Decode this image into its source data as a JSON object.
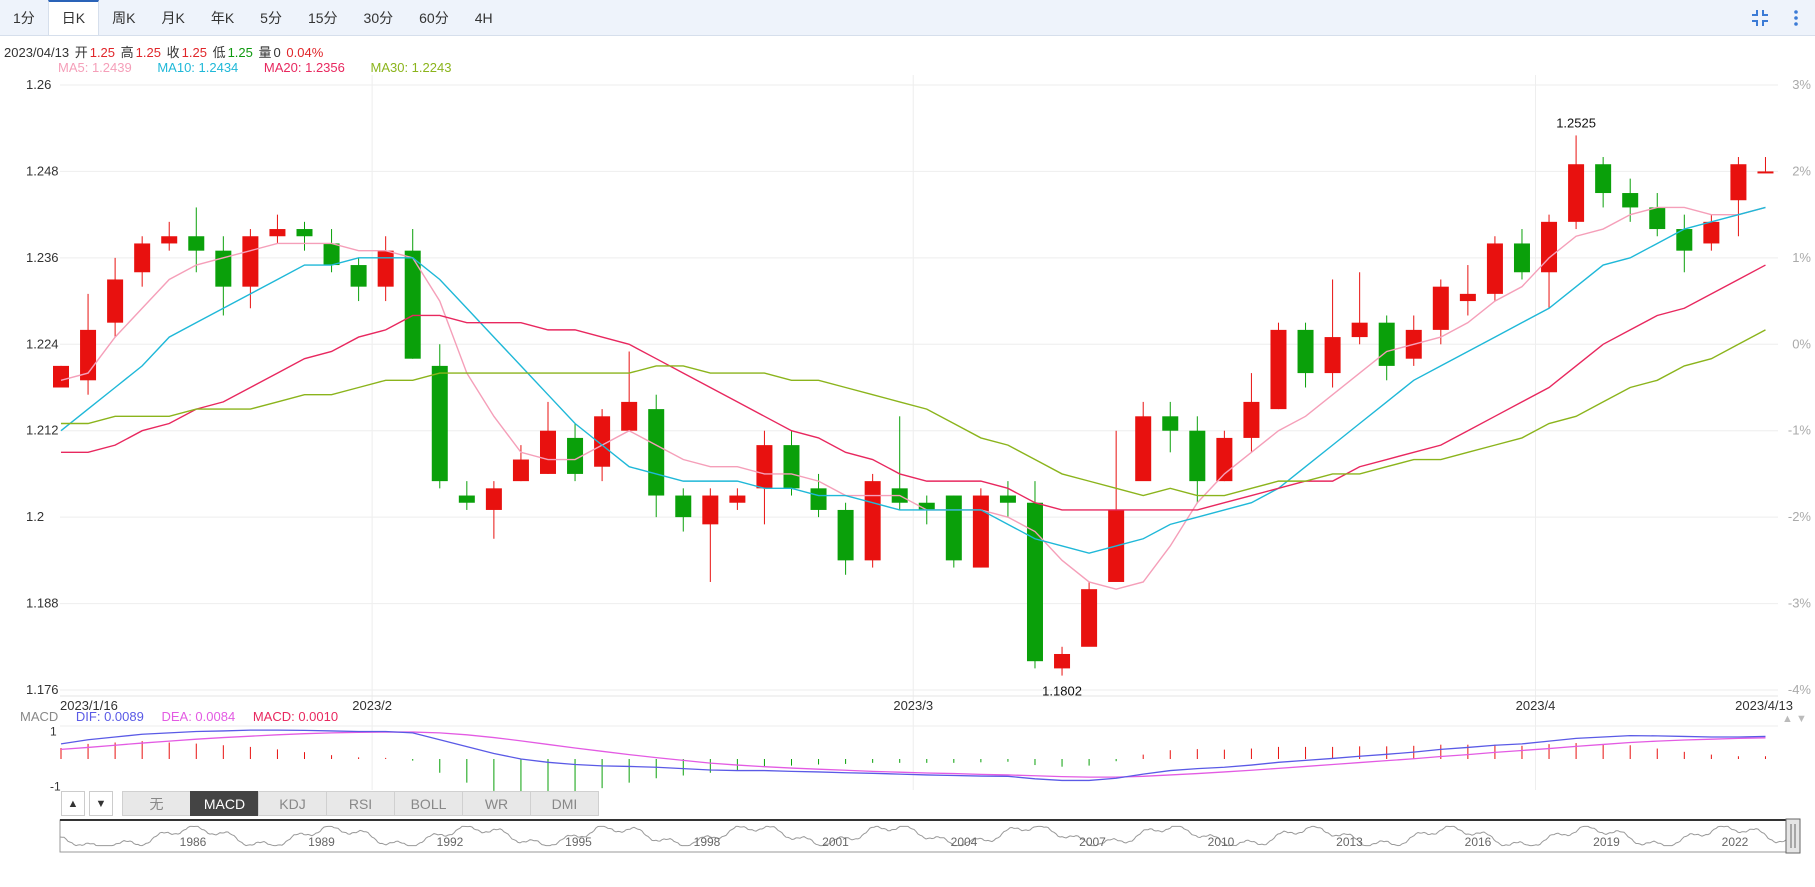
{
  "toolbar": {
    "timeframes": [
      "1分",
      "日K",
      "周K",
      "月K",
      "年K",
      "5分",
      "15分",
      "30分",
      "60分",
      "4H"
    ],
    "active_index": 1
  },
  "info": {
    "date": "2023/04/13",
    "open_label": "开",
    "open": "1.25",
    "high_label": "高",
    "high": "1.25",
    "close_label": "收",
    "close": "1.25",
    "low_label": "低",
    "low": "1.25",
    "vol_label": "量",
    "vol": "0",
    "change": "0.04%"
  },
  "ma": [
    {
      "label": "MA5: 1.2439",
      "color": "#f59fb9"
    },
    {
      "label": "MA10: 1.2434",
      "color": "#1fb8d8"
    },
    {
      "label": "MA20: 1.2356",
      "color": "#e8285f"
    },
    {
      "label": "MA30: 1.2243",
      "color": "#8bb41c"
    }
  ],
  "macd_legend": {
    "name": "MACD",
    "dif": "DIF: 0.0089",
    "dea": "DEA: 0.0084",
    "macd": "MACD: 0.0010"
  },
  "indicator_tabs": {
    "up": "▲",
    "down": "▼",
    "tabs": [
      "无",
      "MACD",
      "KDJ",
      "RSI",
      "BOLL",
      "WR",
      "DMI"
    ],
    "active_index": 1
  },
  "overview": {
    "year_labels": [
      "1986",
      "1989",
      "1992",
      "1995",
      "1998",
      "2001",
      "2004",
      "2007",
      "2010",
      "2013",
      "2016",
      "2019",
      "2022"
    ]
  },
  "colors": {
    "up": "#e8110f",
    "down": "#0aa00a",
    "ma5": "#f59fb9",
    "ma10": "#1fb8d8",
    "ma20": "#e8285f",
    "ma30": "#8bb41c",
    "dif": "#5a5ae6",
    "dea": "#e35be3"
  },
  "chart_data": {
    "type": "candlestick",
    "price_axis": {
      "min": 1.176,
      "max": 1.26,
      "ticks": [
        "1.26",
        "1.248",
        "1.236",
        "1.224",
        "1.212",
        "1.2",
        "1.188",
        "1.176"
      ]
    },
    "pct_axis": {
      "ticks": [
        "3%",
        "2%",
        "1%",
        "0%",
        "-1%",
        "-2%",
        "-3%",
        "-4%"
      ]
    },
    "date_labels": [
      "2023/1/16",
      "2023/2",
      "2023/3",
      "2023/4",
      "2023/4/13"
    ],
    "annotations": {
      "max_label": "1.2525",
      "min_label": "1.1802"
    },
    "ohlc": [
      [
        1.218,
        1.221,
        1.218,
        1.221
      ],
      [
        1.219,
        1.226,
        1.231,
        1.217
      ],
      [
        1.227,
        1.233,
        1.236,
        1.225
      ],
      [
        1.234,
        1.238,
        1.239,
        1.232
      ],
      [
        1.238,
        1.239,
        1.241,
        1.237
      ],
      [
        1.239,
        1.237,
        1.243,
        1.234
      ],
      [
        1.237,
        1.232,
        1.239,
        1.228
      ],
      [
        1.232,
        1.239,
        1.24,
        1.229
      ],
      [
        1.239,
        1.24,
        1.242,
        1.238
      ],
      [
        1.24,
        1.239,
        1.241,
        1.237
      ],
      [
        1.238,
        1.235,
        1.24,
        1.234
      ],
      [
        1.235,
        1.232,
        1.236,
        1.23
      ],
      [
        1.232,
        1.237,
        1.239,
        1.23
      ],
      [
        1.237,
        1.222,
        1.24,
        1.222
      ],
      [
        1.221,
        1.205,
        1.224,
        1.204
      ],
      [
        1.203,
        1.202,
        1.205,
        1.201
      ],
      [
        1.201,
        1.204,
        1.205,
        1.197
      ],
      [
        1.205,
        1.208,
        1.21,
        1.205
      ],
      [
        1.206,
        1.212,
        1.216,
        1.206
      ],
      [
        1.211,
        1.206,
        1.213,
        1.205
      ],
      [
        1.207,
        1.214,
        1.215,
        1.205
      ],
      [
        1.212,
        1.216,
        1.223,
        1.212
      ],
      [
        1.215,
        1.203,
        1.217,
        1.2
      ],
      [
        1.203,
        1.2,
        1.204,
        1.198
      ],
      [
        1.199,
        1.203,
        1.204,
        1.191
      ],
      [
        1.202,
        1.203,
        1.204,
        1.201
      ],
      [
        1.204,
        1.21,
        1.212,
        1.199
      ],
      [
        1.21,
        1.204,
        1.212,
        1.203
      ],
      [
        1.204,
        1.201,
        1.206,
        1.2
      ],
      [
        1.201,
        1.194,
        1.202,
        1.192
      ],
      [
        1.194,
        1.205,
        1.206,
        1.193
      ],
      [
        1.204,
        1.202,
        1.214,
        1.201
      ],
      [
        1.202,
        1.201,
        1.203,
        1.199
      ],
      [
        1.203,
        1.194,
        1.203,
        1.193
      ],
      [
        1.193,
        1.203,
        1.204,
        1.193
      ],
      [
        1.203,
        1.202,
        1.205,
        1.2
      ],
      [
        1.202,
        1.18,
        1.205,
        1.179
      ],
      [
        1.179,
        1.181,
        1.182,
        1.178
      ],
      [
        1.182,
        1.19,
        1.191,
        1.184
      ],
      [
        1.191,
        1.201,
        1.212,
        1.192
      ],
      [
        1.205,
        1.214,
        1.216,
        1.206
      ],
      [
        1.214,
        1.212,
        1.216,
        1.209
      ],
      [
        1.212,
        1.205,
        1.214,
        1.202
      ],
      [
        1.205,
        1.211,
        1.212,
        1.205
      ],
      [
        1.211,
        1.216,
        1.22,
        1.209
      ],
      [
        1.215,
        1.226,
        1.227,
        1.215
      ],
      [
        1.226,
        1.22,
        1.227,
        1.218
      ],
      [
        1.22,
        1.225,
        1.233,
        1.218
      ],
      [
        1.225,
        1.227,
        1.234,
        1.224
      ],
      [
        1.227,
        1.221,
        1.228,
        1.219
      ],
      [
        1.222,
        1.226,
        1.228,
        1.221
      ],
      [
        1.226,
        1.232,
        1.233,
        1.224
      ],
      [
        1.23,
        1.231,
        1.235,
        1.228
      ],
      [
        1.231,
        1.238,
        1.239,
        1.23
      ],
      [
        1.238,
        1.234,
        1.24,
        1.233
      ],
      [
        1.234,
        1.241,
        1.242,
        1.229
      ],
      [
        1.241,
        1.249,
        1.253,
        1.24
      ],
      [
        1.249,
        1.245,
        1.25,
        1.243
      ],
      [
        1.245,
        1.243,
        1.247,
        1.241
      ],
      [
        1.243,
        1.24,
        1.245,
        1.239
      ],
      [
        1.24,
        1.237,
        1.242,
        1.234
      ],
      [
        1.238,
        1.241,
        1.242,
        1.237
      ],
      [
        1.244,
        1.249,
        1.25,
        1.239
      ],
      [
        1.248,
        1.248,
        1.25,
        1.248
      ]
    ],
    "ma5": [
      1.219,
      1.22,
      1.225,
      1.229,
      1.233,
      1.235,
      1.236,
      1.237,
      1.238,
      1.238,
      1.238,
      1.237,
      1.237,
      1.236,
      1.23,
      1.22,
      1.214,
      1.209,
      1.208,
      1.208,
      1.21,
      1.212,
      1.21,
      1.208,
      1.207,
      1.207,
      1.206,
      1.206,
      1.205,
      1.203,
      1.203,
      1.203,
      1.201,
      1.201,
      1.201,
      1.2,
      1.198,
      1.194,
      1.191,
      1.19,
      1.191,
      1.196,
      1.202,
      1.206,
      1.209,
      1.212,
      1.214,
      1.217,
      1.22,
      1.223,
      1.224,
      1.225,
      1.227,
      1.23,
      1.232,
      1.236,
      1.239,
      1.24,
      1.242,
      1.243,
      1.243,
      1.242,
      1.242,
      1.243
    ],
    "ma10": [
      1.212,
      1.215,
      1.218,
      1.221,
      1.225,
      1.227,
      1.229,
      1.231,
      1.233,
      1.235,
      1.235,
      1.236,
      1.236,
      1.236,
      1.233,
      1.229,
      1.225,
      1.221,
      1.217,
      1.213,
      1.21,
      1.207,
      1.206,
      1.205,
      1.205,
      1.205,
      1.204,
      1.204,
      1.203,
      1.203,
      1.202,
      1.201,
      1.201,
      1.201,
      1.201,
      1.199,
      1.197,
      1.196,
      1.195,
      1.196,
      1.197,
      1.199,
      1.2,
      1.201,
      1.202,
      1.204,
      1.207,
      1.21,
      1.213,
      1.216,
      1.219,
      1.221,
      1.223,
      1.225,
      1.227,
      1.229,
      1.232,
      1.235,
      1.236,
      1.238,
      1.24,
      1.241,
      1.242,
      1.243
    ],
    "ma20": [
      1.209,
      1.209,
      1.21,
      1.212,
      1.213,
      1.215,
      1.216,
      1.218,
      1.22,
      1.222,
      1.223,
      1.225,
      1.226,
      1.228,
      1.228,
      1.227,
      1.227,
      1.227,
      1.226,
      1.226,
      1.225,
      1.224,
      1.222,
      1.22,
      1.218,
      1.216,
      1.214,
      1.212,
      1.211,
      1.209,
      1.208,
      1.206,
      1.205,
      1.205,
      1.205,
      1.204,
      1.202,
      1.201,
      1.201,
      1.201,
      1.201,
      1.201,
      1.201,
      1.202,
      1.203,
      1.204,
      1.205,
      1.205,
      1.207,
      1.208,
      1.209,
      1.21,
      1.212,
      1.214,
      1.216,
      1.218,
      1.221,
      1.224,
      1.226,
      1.228,
      1.229,
      1.231,
      1.233,
      1.235
    ],
    "ma30": [
      1.213,
      1.213,
      1.214,
      1.214,
      1.214,
      1.215,
      1.215,
      1.215,
      1.216,
      1.217,
      1.217,
      1.218,
      1.219,
      1.219,
      1.22,
      1.22,
      1.22,
      1.22,
      1.22,
      1.22,
      1.22,
      1.22,
      1.221,
      1.221,
      1.22,
      1.22,
      1.22,
      1.219,
      1.219,
      1.218,
      1.217,
      1.216,
      1.215,
      1.213,
      1.211,
      1.21,
      1.208,
      1.206,
      1.205,
      1.204,
      1.203,
      1.204,
      1.203,
      1.203,
      1.204,
      1.205,
      1.205,
      1.206,
      1.206,
      1.207,
      1.208,
      1.208,
      1.209,
      1.21,
      1.211,
      1.213,
      1.214,
      1.216,
      1.218,
      1.219,
      1.221,
      1.222,
      1.224,
      1.226
    ],
    "macd_axis": {
      "ticks": [
        "1",
        "-1"
      ],
      "min": -1.2,
      "max": 1.2
    },
    "dif": [
      0.55,
      0.7,
      0.8,
      0.9,
      0.95,
      1.0,
      1.02,
      1.05,
      1.05,
      1.04,
      1.02,
      1.0,
      1.0,
      0.95,
      0.7,
      0.45,
      0.2,
      0.0,
      -0.12,
      -0.2,
      -0.25,
      -0.27,
      -0.3,
      -0.35,
      -0.4,
      -0.42,
      -0.42,
      -0.45,
      -0.47,
      -0.5,
      -0.52,
      -0.55,
      -0.58,
      -0.6,
      -0.62,
      -0.63,
      -0.72,
      -0.78,
      -0.78,
      -0.7,
      -0.55,
      -0.42,
      -0.35,
      -0.3,
      -0.22,
      -0.12,
      -0.05,
      0.02,
      0.1,
      0.17,
      0.25,
      0.35,
      0.42,
      0.5,
      0.55,
      0.65,
      0.75,
      0.8,
      0.85,
      0.84,
      0.82,
      0.8,
      0.8,
      0.82
    ],
    "dea": [
      0.35,
      0.42,
      0.5,
      0.58,
      0.65,
      0.72,
      0.78,
      0.83,
      0.88,
      0.92,
      0.95,
      0.97,
      0.98,
      0.98,
      0.95,
      0.88,
      0.78,
      0.66,
      0.53,
      0.4,
      0.28,
      0.16,
      0.05,
      -0.05,
      -0.15,
      -0.22,
      -0.28,
      -0.33,
      -0.37,
      -0.41,
      -0.45,
      -0.48,
      -0.51,
      -0.53,
      -0.56,
      -0.58,
      -0.61,
      -0.64,
      -0.66,
      -0.66,
      -0.63,
      -0.58,
      -0.53,
      -0.47,
      -0.41,
      -0.34,
      -0.27,
      -0.2,
      -0.13,
      -0.06,
      0.01,
      0.09,
      0.16,
      0.24,
      0.31,
      0.38,
      0.46,
      0.53,
      0.6,
      0.65,
      0.69,
      0.72,
      0.75,
      0.77
    ],
    "macd": [
      0.4,
      0.55,
      0.6,
      0.65,
      0.6,
      0.56,
      0.5,
      0.44,
      0.35,
      0.25,
      0.14,
      0.06,
      0.04,
      -0.06,
      -0.5,
      -0.86,
      -1.16,
      -1.32,
      -1.3,
      -1.2,
      -1.06,
      -0.86,
      -0.7,
      -0.6,
      -0.5,
      -0.4,
      -0.28,
      -0.24,
      -0.2,
      -0.18,
      -0.14,
      -0.14,
      -0.14,
      -0.14,
      -0.12,
      -0.1,
      -0.22,
      -0.28,
      -0.24,
      -0.08,
      0.16,
      0.32,
      0.36,
      0.34,
      0.38,
      0.44,
      0.44,
      0.44,
      0.46,
      0.46,
      0.48,
      0.52,
      0.52,
      0.52,
      0.48,
      0.54,
      0.58,
      0.54,
      0.5,
      0.38,
      0.26,
      0.16,
      0.1,
      0.1
    ]
  }
}
